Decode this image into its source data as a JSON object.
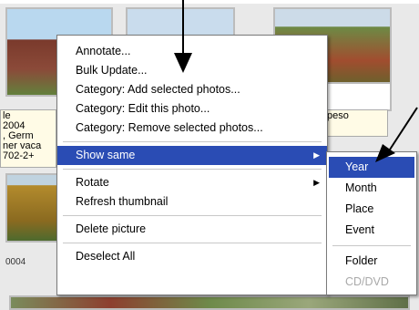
{
  "context_menu": {
    "groups": [
      [
        {
          "label": "Annotate..."
        },
        {
          "label": "Bulk Update..."
        },
        {
          "label": "Category: Add selected photos..."
        },
        {
          "label": "Category: Edit this photo..."
        },
        {
          "label": "Category: Remove selected photos..."
        }
      ]
    ],
    "show_same": "Show same",
    "rotate": "Rotate",
    "refresh_thumbnail": "Refresh thumbnail",
    "delete_picture": "Delete picture",
    "deselect_all": "Deselect All"
  },
  "submenu": {
    "year": "Year",
    "month": "Month",
    "place": "Place",
    "event": "Event",
    "folder": "Folder",
    "cd_dvd": "CD/DVD"
  },
  "captions": {
    "left_lines": [
      "le",
      "2004",
      ", Germ",
      "ner vaca",
      "702-2+"
    ],
    "right": "peso",
    "thumb_number": "0004"
  },
  "colors": {
    "highlight": "#2a4cb4",
    "arrow": "#000000"
  }
}
